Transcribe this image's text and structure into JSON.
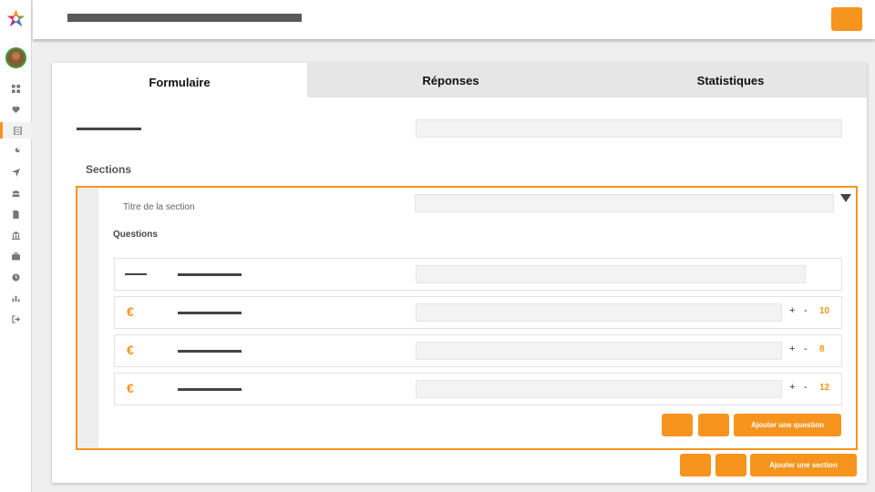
{
  "colors": {
    "accent": "#f7941d",
    "text_dark": "#111111"
  },
  "sidebar": {
    "logo_icon": "star-logo-icon",
    "items": [
      {
        "icon": "grid-icon"
      },
      {
        "icon": "heart-icon"
      },
      {
        "icon": "form-icon",
        "active": true
      },
      {
        "icon": "wrench-icon"
      },
      {
        "icon": "send-icon"
      },
      {
        "icon": "users-icon"
      },
      {
        "icon": "document-icon"
      },
      {
        "icon": "bank-icon"
      },
      {
        "icon": "briefcase-icon"
      },
      {
        "icon": "clock-icon"
      },
      {
        "icon": "chart-icon"
      },
      {
        "icon": "logout-icon"
      }
    ]
  },
  "tabs": [
    {
      "label": "Formulaire",
      "active": true
    },
    {
      "label": "Réponses"
    },
    {
      "label": "Statistiques"
    }
  ],
  "main": {
    "sections_title": "Sections",
    "section": {
      "title_label": "Titre de la section",
      "questions_title": "Questions",
      "questions": [
        {
          "icon": "dash-icon"
        },
        {
          "icon": "euro-icon",
          "symbol": "€",
          "count": "10"
        },
        {
          "icon": "euro-icon",
          "symbol": "€",
          "count": "8"
        },
        {
          "icon": "euro-icon",
          "symbol": "€",
          "count": "12"
        }
      ],
      "plus": "+",
      "minus": "-",
      "add_question_label": "Ajouter une question"
    },
    "add_section_label": "Ajouter une section"
  }
}
